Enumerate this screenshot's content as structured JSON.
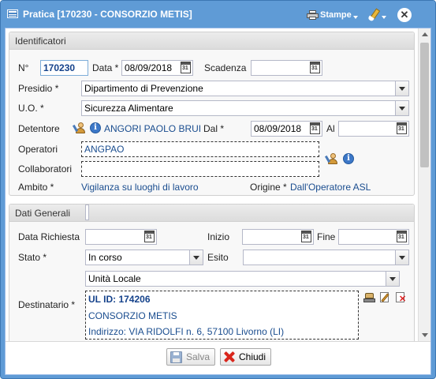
{
  "window": {
    "title": "Pratica [170230 - CONSORZIO METIS]",
    "stampe_label": "Stampe",
    "close_glyph": "✕"
  },
  "identificatori": {
    "legend": "Identificatori",
    "numero_label": "N°",
    "numero_value": "170230",
    "data_label": "Data *",
    "data_value": "08/09/2018",
    "scadenza_label": "Scadenza",
    "scadenza_value": "",
    "presidio_label": "Presidio *",
    "presidio_value": "Dipartimento di Prevenzione",
    "uo_label": "U.O. *",
    "uo_value": "Sicurezza Alimentare",
    "detentore_label": "Detentore",
    "detentore_value": "ANGORI PAOLO BRUI",
    "dal_label": "Dal *",
    "dal_value": "08/09/2018",
    "al_label": "Al",
    "al_value": "",
    "operatori_label": "Operatori",
    "operatori_value": "ANGPAO",
    "collaboratori_label": "Collaboratori",
    "collaboratori_value": "",
    "ambito_label": "Ambito *",
    "ambito_value": "Vigilanza su luoghi di lavoro",
    "origine_label": "Origine *",
    "origine_value": "Dall'Operatore ASL"
  },
  "dati_generali": {
    "legend": "Dati Generali",
    "data_richiesta_label": "Data Richiesta",
    "data_richiesta_value": "",
    "inizio_label": "Inizio",
    "inizio_value": "",
    "fine_label": "Fine",
    "fine_value": "",
    "stato_label": "Stato *",
    "stato_value": "In corso",
    "esito_label": "Esito",
    "esito_value": "",
    "destinatario_label": "Destinatario *",
    "destinatario_tipo": "Unità Locale",
    "destinatario_id": "UL ID: 174206",
    "destinatario_nome": "CONSORZIO METIS",
    "destinatario_indirizzo": "Indirizzo: VIA RIDOLFI n. 6, 57100 Livorno (LI)"
  },
  "footer": {
    "salva_label": "Salva",
    "chiudi_label": "Chiudi"
  },
  "colors": {
    "titlebar": "#5f9bd6",
    "link": "#15428b",
    "close_x": "#d9261c"
  }
}
